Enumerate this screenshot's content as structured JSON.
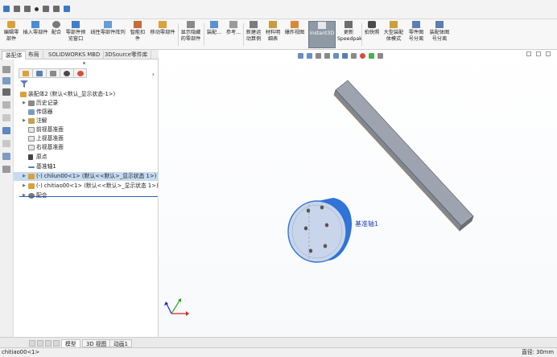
{
  "ribbon": {
    "buttons": [
      {
        "label": "编辑零\n部件"
      },
      {
        "label": "插入零部件"
      },
      {
        "label": "配合"
      },
      {
        "label": "零部件预\n览窗口"
      },
      {
        "label": "线性零部件阵列"
      },
      {
        "label": "智能扣\n件"
      },
      {
        "label": "移动零部件"
      },
      {
        "label": "显示隐藏\n的零部件"
      },
      {
        "label": "装配..."
      },
      {
        "label": "参考..."
      },
      {
        "label": "新建运\n动算例"
      },
      {
        "label": "材料明\n细表"
      },
      {
        "label": "爆炸视图"
      },
      {
        "label": "Instant3D"
      },
      {
        "label": "更新\nSpeedpak"
      },
      {
        "label": "拍快照"
      },
      {
        "label": "大型装配\n体模式"
      },
      {
        "label": "零件图\n号分离"
      },
      {
        "label": "装配体图\n号分离"
      }
    ]
  },
  "command_tabs": [
    "装配体",
    "布局",
    "SOLIDWORKS MBD",
    "3DSource零件库"
  ],
  "tree": {
    "root": "装配体2  (默认<默认_显示状态-1>)",
    "items": [
      "历史记录",
      "传感器",
      "注解",
      "前视基准面",
      "上视基准面",
      "右视基准面",
      "原点",
      "基准轴1",
      "(-) chilun00<1> (默认<<默认>_显示状态 1>)",
      "(-) chitiao00<1> (默认<<默认>_显示状态 1>)",
      "配合"
    ]
  },
  "viewport": {
    "axis_label": "基准轴1"
  },
  "bottom_tabs": [
    "模型",
    "3D 视图",
    "动画1"
  ],
  "status": {
    "left": "chitiao00<1>",
    "right": "直径: 30mm"
  },
  "colors": {
    "accent_blue": "#2f74d6",
    "selection": "#c6dbf2",
    "active_ribbon": "#8e9aa6"
  }
}
